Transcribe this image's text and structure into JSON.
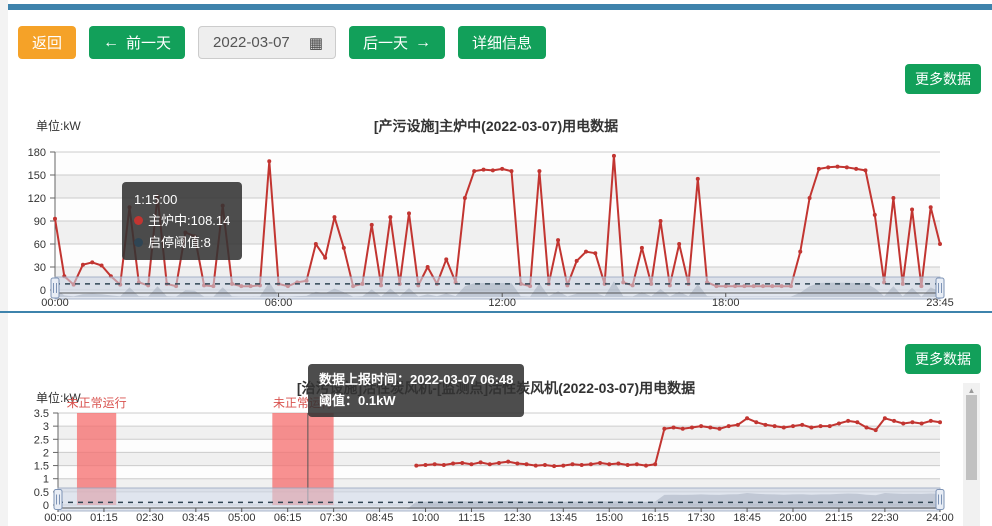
{
  "toolbar": {
    "back_label": "返回",
    "prev_day_label": "前一天",
    "date_value": "2022-03-07",
    "next_day_label": "后一天",
    "detail_label": "详细信息"
  },
  "icons": {
    "arrow_left": "←",
    "arrow_right": "→",
    "calendar": "▦",
    "scroll_up": "▲"
  },
  "colors": {
    "accent_green": "#12a05a",
    "accent_orange": "#f5a228",
    "blue_bar": "#3e83ac",
    "series_red": "#c23531",
    "threshold_navy": "#2f4554",
    "abnormal_band": "#f56c6c",
    "abnormal_text": "#d9534f"
  },
  "chart1": {
    "more_label": "更多数据",
    "unit_label": "单位:kW",
    "tooltip": {
      "line1": "1:15:00",
      "line2": "主炉中:108.14",
      "line3": "启停阈值:8"
    }
  },
  "chart2": {
    "more_label": "更多数据",
    "unit_label": "单位:kW",
    "tooltip": {
      "line1": "数据上报时间：2022-03-07 06:48",
      "line2": "阈值：0.1kW"
    }
  },
  "chart_data": [
    {
      "type": "line",
      "title": "[产污设施]主炉中(2022-03-07)用电数据",
      "unit": "kW",
      "series_name": "主炉中",
      "color": "#c23531",
      "interval_minutes": 15,
      "x_step_count": 95,
      "x_tick_labels": [
        "00:00",
        "06:00",
        "12:00",
        "18:00",
        "23:45"
      ],
      "x_tick_fracs": [
        0,
        0.2526,
        0.5053,
        0.7579,
        1
      ],
      "y_ticks": [
        180,
        150,
        120,
        90,
        60,
        30,
        0
      ],
      "ylim": [
        0,
        180
      ],
      "grid": true,
      "legend_position": "none",
      "threshold": {
        "name": "启停阈值",
        "value": 8
      },
      "values": [
        93,
        18,
        7,
        33,
        36,
        32,
        18,
        7,
        108,
        10,
        6,
        122,
        8,
        5,
        75,
        70,
        6,
        5,
        110,
        8,
        5,
        5,
        6,
        168,
        8,
        5,
        10,
        12,
        60,
        42,
        95,
        55,
        5,
        8,
        85,
        6,
        95,
        8,
        100,
        6,
        30,
        8,
        40,
        10,
        120,
        155,
        157,
        156,
        158,
        155,
        8,
        5,
        155,
        8,
        65,
        6,
        38,
        50,
        48,
        8,
        175,
        10,
        6,
        55,
        8,
        90,
        6,
        60,
        8,
        145,
        10,
        5,
        5,
        5,
        5,
        5,
        5,
        5,
        5,
        5,
        50,
        120,
        158,
        160,
        161,
        160,
        158,
        156,
        98,
        10,
        120,
        8,
        105,
        5,
        108,
        60
      ]
    },
    {
      "type": "line",
      "title": "[治污设施]活性炭风机-[监测点]活性炭风机(2022-03-07)用电数据",
      "unit": "kW",
      "series_name": "活性炭风机",
      "color": "#c23531",
      "interval_minutes": 15,
      "x_step_count": 96,
      "x_tick_labels": [
        "00:00",
        "01:15",
        "02:30",
        "03:45",
        "05:00",
        "06:15",
        "07:30",
        "08:45",
        "10:00",
        "11:15",
        "12:30",
        "13:45",
        "15:00",
        "16:15",
        "17:30",
        "18:45",
        "20:00",
        "21:15",
        "22:30",
        "24:00"
      ],
      "x_tick_fracs": [
        0,
        0.0521,
        0.1042,
        0.1563,
        0.2083,
        0.2604,
        0.3125,
        0.3646,
        0.4167,
        0.4688,
        0.5208,
        0.5729,
        0.625,
        0.6771,
        0.7292,
        0.7813,
        0.8333,
        0.8854,
        0.9375,
        1
      ],
      "y_ticks": [
        3.5,
        3,
        2.5,
        2,
        1.5,
        1,
        0.5,
        0
      ],
      "ylim": [
        0,
        3.5
      ],
      "grid": true,
      "legend_position": "none",
      "threshold": {
        "name": "阈值",
        "value": 0.1
      },
      "crosshair_frac": 0.2833,
      "abnormal_regions": [
        {
          "start_frac": 0.0215,
          "end_frac": 0.066,
          "label": "未正常运行"
        },
        {
          "start_frac": 0.243,
          "end_frac": 0.3125,
          "label": "未正常运行"
        }
      ],
      "values": [
        null,
        null,
        null,
        null,
        null,
        null,
        null,
        null,
        null,
        null,
        null,
        null,
        null,
        null,
        null,
        null,
        null,
        null,
        null,
        null,
        null,
        null,
        null,
        null,
        null,
        null,
        null,
        null,
        null,
        null,
        null,
        null,
        null,
        null,
        null,
        null,
        null,
        null,
        null,
        1.5,
        1.52,
        1.55,
        1.52,
        1.58,
        1.6,
        1.55,
        1.62,
        1.55,
        1.6,
        1.65,
        1.58,
        1.55,
        1.5,
        1.52,
        1.48,
        1.5,
        1.55,
        1.52,
        1.55,
        1.6,
        1.55,
        1.58,
        1.52,
        1.55,
        1.5,
        1.55,
        2.9,
        2.95,
        2.9,
        2.95,
        3.0,
        2.95,
        2.9,
        3.0,
        3.05,
        3.3,
        3.15,
        3.05,
        3.0,
        2.95,
        3.0,
        3.05,
        2.95,
        3.0,
        3.0,
        3.1,
        3.2,
        3.15,
        2.95,
        2.85,
        3.3,
        3.2,
        3.1,
        3.15,
        3.1,
        3.2,
        3.15
      ]
    }
  ]
}
